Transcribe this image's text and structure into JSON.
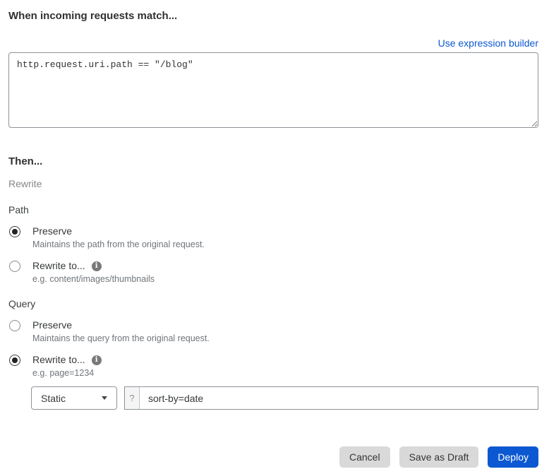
{
  "colors": {
    "accent_blue": "#0b58d2",
    "link_blue": "#0b58d2",
    "secondary_button_gray": "#d9d9d9",
    "border_gray": "#8d9399"
  },
  "match": {
    "title": "When incoming requests match...",
    "builder_link_label": "Use expression builder",
    "expression_value": "http.request.uri.path == \"/blog\""
  },
  "then": {
    "title": "Then...",
    "action_label": "Rewrite",
    "path": {
      "label": "Path",
      "preserve": {
        "label": "Preserve",
        "description": "Maintains the path from the original request.",
        "selected": true
      },
      "rewrite": {
        "label": "Rewrite to...",
        "description": "e.g. content/images/thumbnails",
        "selected": false,
        "info_icon": "info-icon"
      }
    },
    "query": {
      "label": "Query",
      "preserve": {
        "label": "Preserve",
        "description": "Maintains the query from the original request.",
        "selected": false
      },
      "rewrite": {
        "label": "Rewrite to...",
        "description": "e.g. page=1234",
        "selected": true,
        "info_icon": "info-icon"
      },
      "value_editor": {
        "type_selected": "Static",
        "dropdown_icon": "chevron-down-icon",
        "prefix": "?",
        "input_value": "sort-by=date"
      }
    }
  },
  "footer": {
    "cancel_label": "Cancel",
    "save_draft_label": "Save as Draft",
    "deploy_label": "Deploy"
  }
}
